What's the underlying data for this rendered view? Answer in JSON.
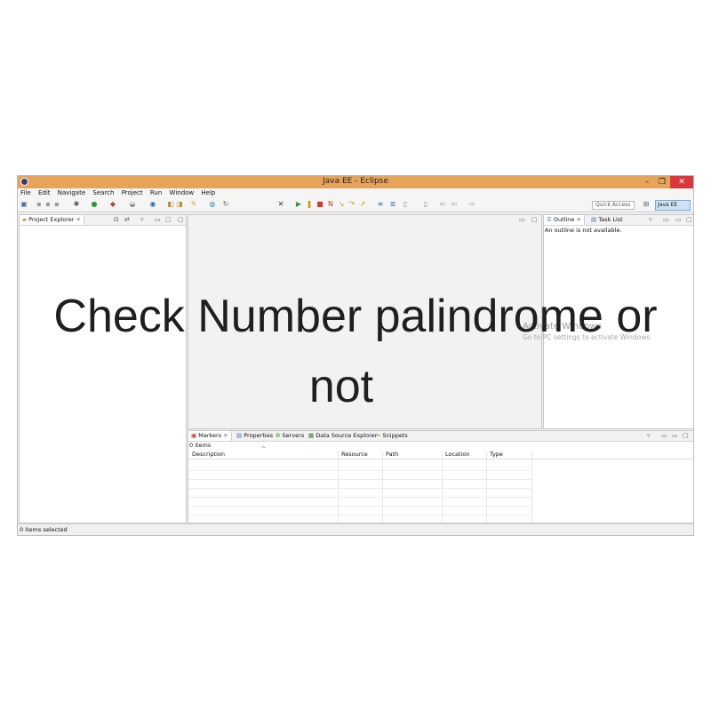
{
  "window": {
    "title": "Java EE - Eclipse",
    "controls": {
      "minimize": "–",
      "restore": "❐",
      "close": "✕"
    }
  },
  "menu": [
    "File",
    "Edit",
    "Navigate",
    "Search",
    "Project",
    "Run",
    "Window",
    "Help"
  ],
  "toolbar": {
    "quick_access_placeholder": "Quick Access",
    "perspective": "Java EE"
  },
  "project_explorer": {
    "tab_label": "Project Explorer"
  },
  "outline": {
    "tab_label": "Outline",
    "task_list_label": "Task List",
    "message": "An outline is not available."
  },
  "bottom_panel": {
    "tabs": [
      "Markers",
      "Properties",
      "Servers",
      "Data Source Explorer",
      "Snippets"
    ],
    "item_count": "0 items",
    "columns": [
      "Description",
      "Resource",
      "Path",
      "Location",
      "Type"
    ]
  },
  "status_bar": {
    "text": "0 items selected"
  },
  "watermark": {
    "line1": "Activate Windows",
    "line2": "Go to PC settings to activate Windows."
  },
  "overlay_text": {
    "line1": "Check Number palindrome or",
    "line2": "not"
  },
  "colors": {
    "titlebar": "#e8a35a",
    "close": "#d9373b",
    "perspective": "#cfe2f5"
  }
}
